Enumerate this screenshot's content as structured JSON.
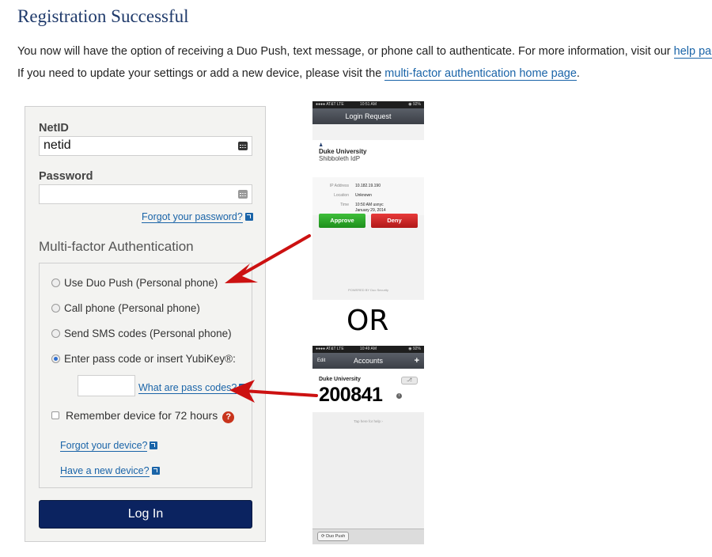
{
  "page": {
    "title": "Registration Successful",
    "intro1_text": "You now will have the option of receiving a Duo Push, text message, or phone call to authenticate. For more information, visit our ",
    "intro1_link": "help page",
    "intro1_end": ".",
    "intro2_text": "If you need to update your settings or add a new device, please visit the ",
    "intro2_link": "multi-factor authentication home page",
    "intro2_end": "."
  },
  "login": {
    "netid_label": "NetID",
    "netid_value": "netid",
    "password_label": "Password",
    "password_value": "",
    "forgot_password": "Forgot your password?",
    "mfa_heading": "Multi-factor Authentication",
    "options": [
      {
        "label": "Use Duo Push (Personal phone)",
        "selected": false
      },
      {
        "label": "Call phone (Personal phone)",
        "selected": false
      },
      {
        "label": "Send SMS codes (Personal phone)",
        "selected": false
      },
      {
        "label": "Enter pass code or insert YubiKey®:",
        "selected": true
      }
    ],
    "passcode_value": "",
    "what_are_pass_codes": "What are pass codes?",
    "remember_device": "Remember device for 72 hours",
    "help_icon": "?",
    "forgot_device": "Forgot your device?",
    "new_device": "Have a new device?",
    "login_button": "Log In"
  },
  "phone1": {
    "status_carrier": "●●●● AT&T  LTE",
    "status_time": "10:51 AM",
    "status_battery": "◉ 92%",
    "nav_title": "Login Request",
    "university": "Duke University",
    "idp": "Shibboleth IdP",
    "ip_label": "IP Address",
    "ip_value": "10.182.19.190",
    "location_label": "Location",
    "location_value": "Unknown",
    "time_label": "Time",
    "time_value_1": "10:50 AM usnyc",
    "time_value_2": "January 29, 2014",
    "approve": "Approve",
    "deny": "Deny",
    "powered": "POWERED BY Duo Security"
  },
  "or_text": "OR",
  "phone2": {
    "status_carrier": "●●●● AT&T  LTE",
    "status_time": "10:49 AM",
    "status_battery": "◉ 92%",
    "nav_edit": "Edit",
    "nav_title": "Accounts",
    "nav_plus": "+",
    "university": "Duke University",
    "passcode": "200841",
    "info": "i",
    "tap_help": "Tap here for help  ›",
    "duo_push": "⟳  Duo Push"
  },
  "colors": {
    "title": "#1f3a6b",
    "link": "#1a64a8",
    "login_button": "#0b2360",
    "arrow": "#cc1111",
    "approve": "#2aa628",
    "deny": "#cc2020"
  }
}
